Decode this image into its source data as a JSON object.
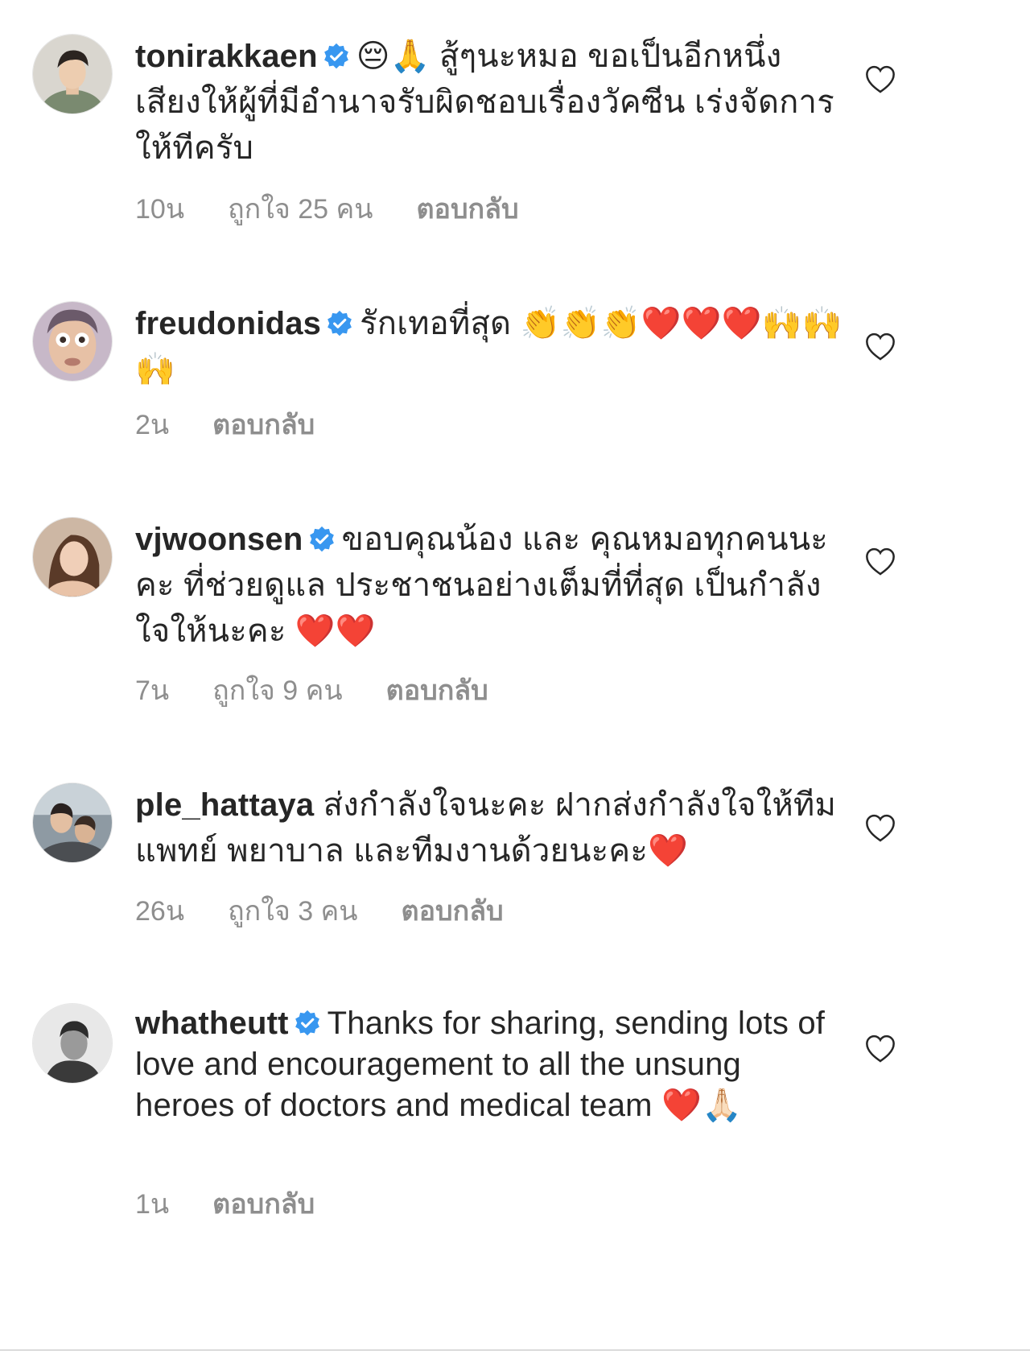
{
  "colors": {
    "text": "#262626",
    "muted": "#8e8e8e",
    "verified": "#3897f0",
    "heart_emoji": "#e0245e"
  },
  "comments": [
    {
      "username": "tonirakkaen",
      "verified": true,
      "text": "😔🙏 สู้ๆนะหมอ ขอเป็นอีกหนึ่งเสียงให้ผู้ที่มีอำนาจรับผิดชอบเรื่องวัคซีน เร่งจัดการให้ทีครับ",
      "time": "10น",
      "likes": "ถูกใจ 25 คน",
      "reply": "ตอบกลับ",
      "avatar_icon": "avatar-photo-icon"
    },
    {
      "username": "freudonidas",
      "verified": true,
      "text": "รักเทอที่สุด 👏👏👏❤️❤️❤️🙌🙌🙌",
      "time": "2น",
      "likes": "",
      "reply": "ตอบกลับ",
      "avatar_icon": "avatar-photo-icon"
    },
    {
      "username": "vjwoonsen",
      "verified": true,
      "text": "ขอบคุณน้อง และ คุณหมอทุกคนนะคะ ที่ช่วยดูแล ประชาชนอย่างเต็มที่ที่สุด เป็นกำลังใจให้นะคะ ❤️❤️",
      "time": "7น",
      "likes": "ถูกใจ 9 คน",
      "reply": "ตอบกลับ",
      "avatar_icon": "avatar-photo-icon"
    },
    {
      "username": "ple_hattaya",
      "verified": false,
      "text": "ส่งกำลังใจนะคะ ฝากส่งกำลังใจให้ทีมแพทย์ พยาบาล และทีมงานด้วยนะคะ❤️",
      "time": "26น",
      "likes": "ถูกใจ 3 คน",
      "reply": "ตอบกลับ",
      "avatar_icon": "avatar-photo-icon"
    },
    {
      "username": "whatheutt",
      "verified": true,
      "text": "Thanks for sharing, sending lots of love and encouragement to all the unsung heroes of doctors and medical team ❤️🙏🏻",
      "time": "1น",
      "likes": "",
      "reply": "ตอบกลับ",
      "avatar_icon": "avatar-photo-icon"
    }
  ],
  "icons": {
    "verified": "verified-badge-icon",
    "like": "heart-outline-icon"
  }
}
